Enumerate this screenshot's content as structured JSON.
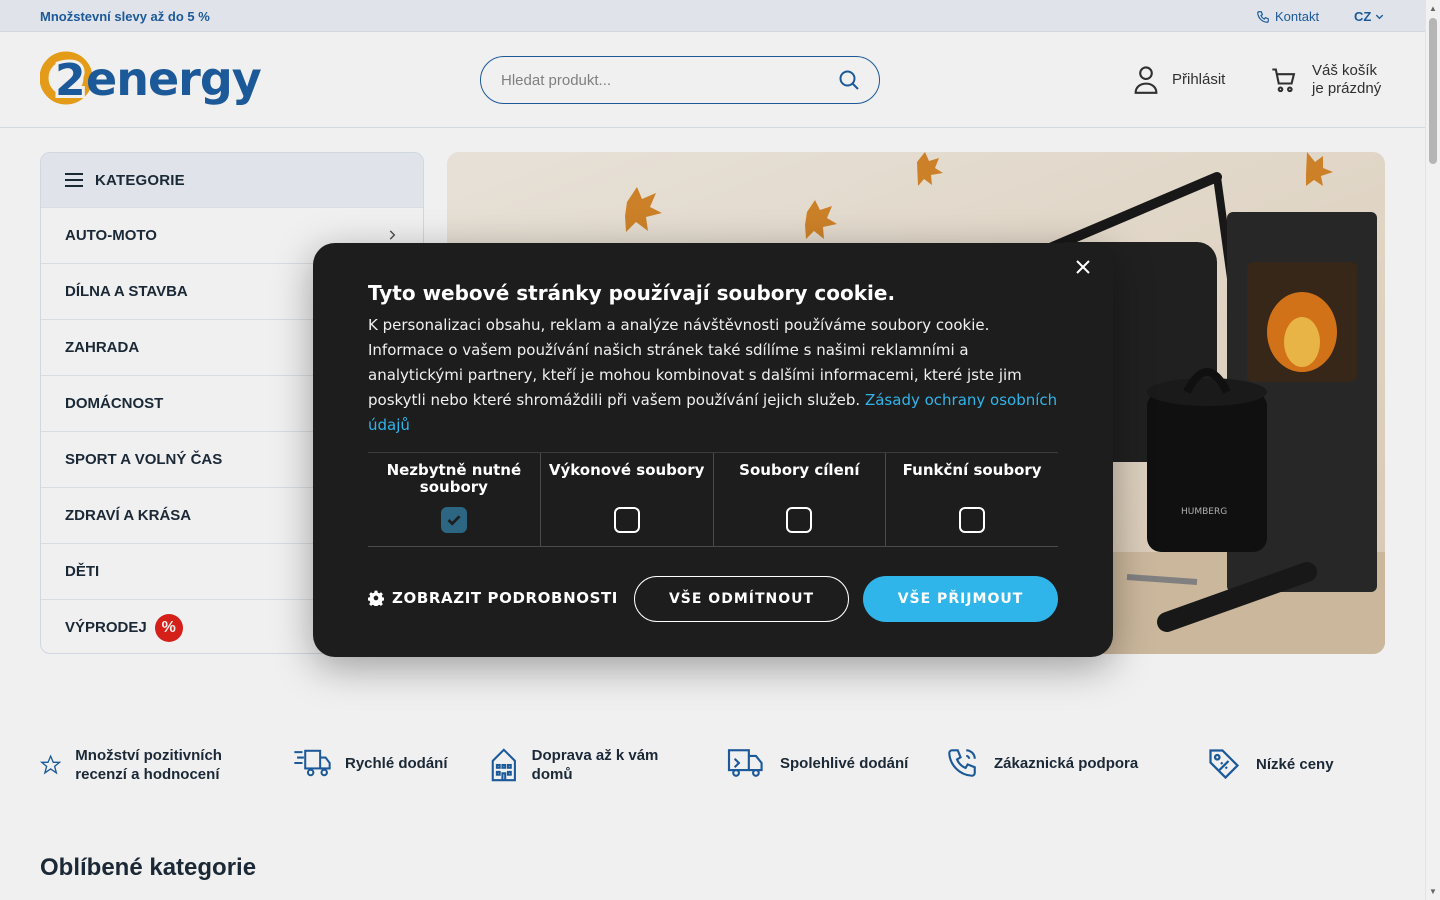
{
  "topbar": {
    "promo": "Množstevní slevy až do 5 %",
    "contact": "Kontakt",
    "language": "CZ"
  },
  "header": {
    "logo_text": "2energy",
    "search_placeholder": "Hledat produkt...",
    "login": "Přihlásit",
    "cart_line1": "Váš košík",
    "cart_line2": "je prázdný"
  },
  "categories": {
    "title": "KATEGORIE",
    "items": [
      {
        "label": "AUTO-MOTO"
      },
      {
        "label": "DÍLNA A STAVBA"
      },
      {
        "label": "ZAHRADA"
      },
      {
        "label": "DOMÁCNOST"
      },
      {
        "label": "SPORT A VOLNÝ ČAS"
      },
      {
        "label": "ZDRAVÍ A KRÁSA"
      },
      {
        "label": "DĚTI"
      },
      {
        "label": "VÝPRODEJ",
        "badge": "%"
      }
    ]
  },
  "banner": {
    "vacuum_brand": "HUMBERG"
  },
  "benefits": [
    {
      "label": "Množství pozitivních recenzí a hodnocení",
      "icon": "star-icon"
    },
    {
      "label": "Rychlé dodání",
      "icon": "fast-truck-icon"
    },
    {
      "label": "Doprava až k vám domů",
      "icon": "house-icon"
    },
    {
      "label": "Spolehlivé dodání",
      "icon": "truck-icon"
    },
    {
      "label": "Zákaznická podpora",
      "icon": "phone-icon"
    },
    {
      "label": "Nízké ceny",
      "icon": "price-tag-icon"
    }
  ],
  "section_title": "Oblíbené kategorie",
  "cookie": {
    "title": "Tyto webové stránky používají soubory cookie.",
    "text": "K personalizaci obsahu, reklam a analýze návštěvnosti používáme soubory cookie. Informace o vašem používání našich stránek také sdílíme s našimi reklamními a analytickými partnery, kteří je mohou kombinovat s dalšími informacemi, které jste jim poskytli nebo které shromáždili při vašem používání jejich služeb.",
    "privacy_link": "Zásady ochrany osobních údajů",
    "options": [
      {
        "label": "Nezbytně nutné soubory",
        "checked": true
      },
      {
        "label": "Výkonové soubory",
        "checked": false
      },
      {
        "label": "Soubory cílení",
        "checked": false
      },
      {
        "label": "Funkční soubory",
        "checked": false
      }
    ],
    "details": "ZOBRAZIT PODROBNOSTI",
    "decline": "VŠE ODMÍTNOUT",
    "accept": "VŠE PŘIJMOUT"
  },
  "colors": {
    "brand_blue": "#1e5fa3",
    "brand_orange": "#f2a51a",
    "accept_blue": "#2fb5ea",
    "modal_bg": "#1d1d1d",
    "sale_red": "#e2231a"
  }
}
